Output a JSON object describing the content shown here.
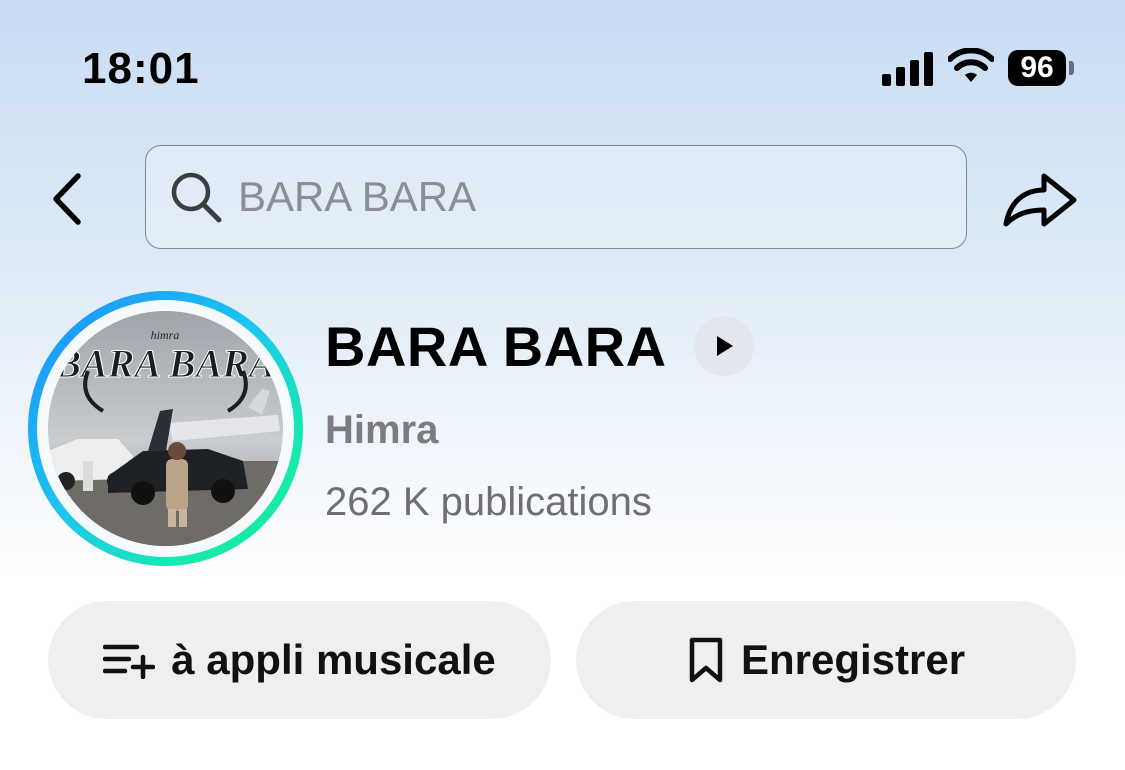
{
  "status_bar": {
    "time": "18:01",
    "battery": "96",
    "icons": [
      "signal-icon",
      "wifi-icon",
      "battery-icon"
    ]
  },
  "header": {
    "search_placeholder": "BARA BARA",
    "icons": [
      "back-icon",
      "search-icon",
      "share-icon"
    ]
  },
  "sound": {
    "title": "BARA BARA",
    "artist": "Himra",
    "posts_count": "262 K publications",
    "cover_logo_text": "BARA BARA"
  },
  "actions": {
    "music_app_label": "à appli musicale",
    "save_label": "Enregistrer"
  },
  "colors": {
    "ring_start": "#1e8cff",
    "ring_end": "#10f08a",
    "pill_bg": "#efefef"
  }
}
